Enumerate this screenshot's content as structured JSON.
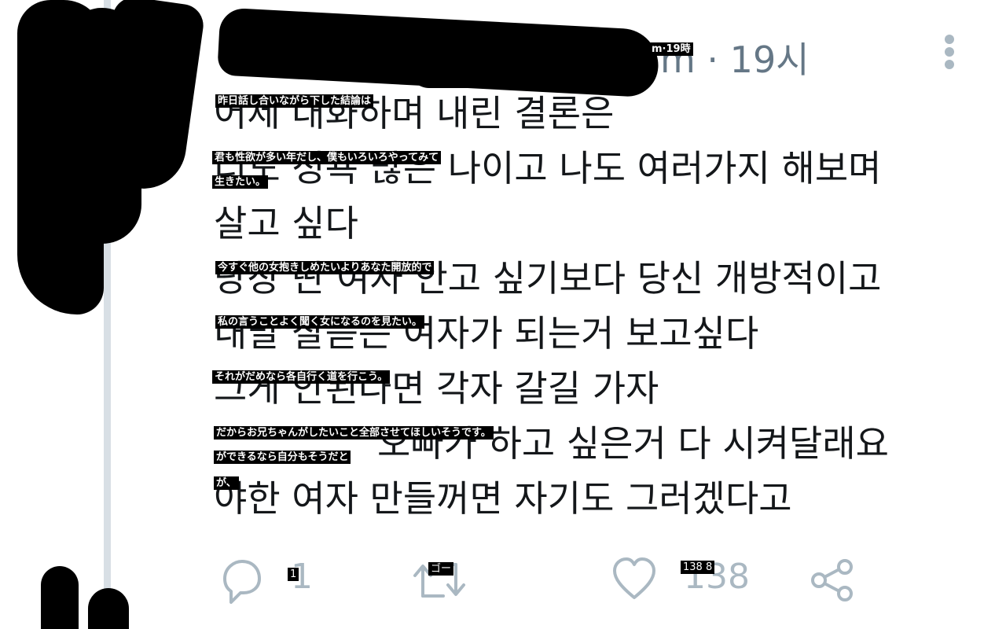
{
  "tweet": {
    "time": "m · 19시",
    "time_caption": "m·19時",
    "lines": [
      {
        "ko": "어제 대화하며 내린 결론은",
        "ja": "昨日話し合いながら下した結論は"
      },
      {
        "ko": "너도 성욕 많은 나이고 나도 여러가지 해보며",
        "ja": "君も性欲が多い年だし、僕もいろいろやってみて"
      },
      {
        "ko": "살고 싶다",
        "ja": "生きたい。"
      },
      {
        "ko": "당장 딴 여자 안고 싶기보다 당신 개방적이고",
        "ja": "今すぐ他の女抱きしめたいよりあなた開放的で"
      },
      {
        "ko": "내말 잘듣는 여자가 되는거 보고싶다",
        "ja": "私の言うことよく聞く女になるのを見たい。"
      },
      {
        "ko": "그게 안된다면 각자 갈길 가자",
        "ja": "それがだめなら各自行く道を行こう。"
      },
      {
        "ko": "오빠가 하고 싶은거 다 시켜달래요",
        "ja": "だからお兄ちゃんがしたいこと全部させてほしいそうです。"
      },
      {
        "ko": "야한 여자 만들꺼면 자기도 그러겠다고",
        "ja": "ができるなら自分もそうだと"
      }
    ],
    "extra_caption": "が、"
  },
  "actions": {
    "reply_count": "1",
    "reply_caption": "1",
    "retweet_caption": "ゴー",
    "like_count": "138",
    "like_caption": "138 8"
  },
  "colors": {
    "text": "#14171a",
    "muted": "#aab8c2",
    "time": "#657786",
    "thread": "#d8dfe5"
  }
}
